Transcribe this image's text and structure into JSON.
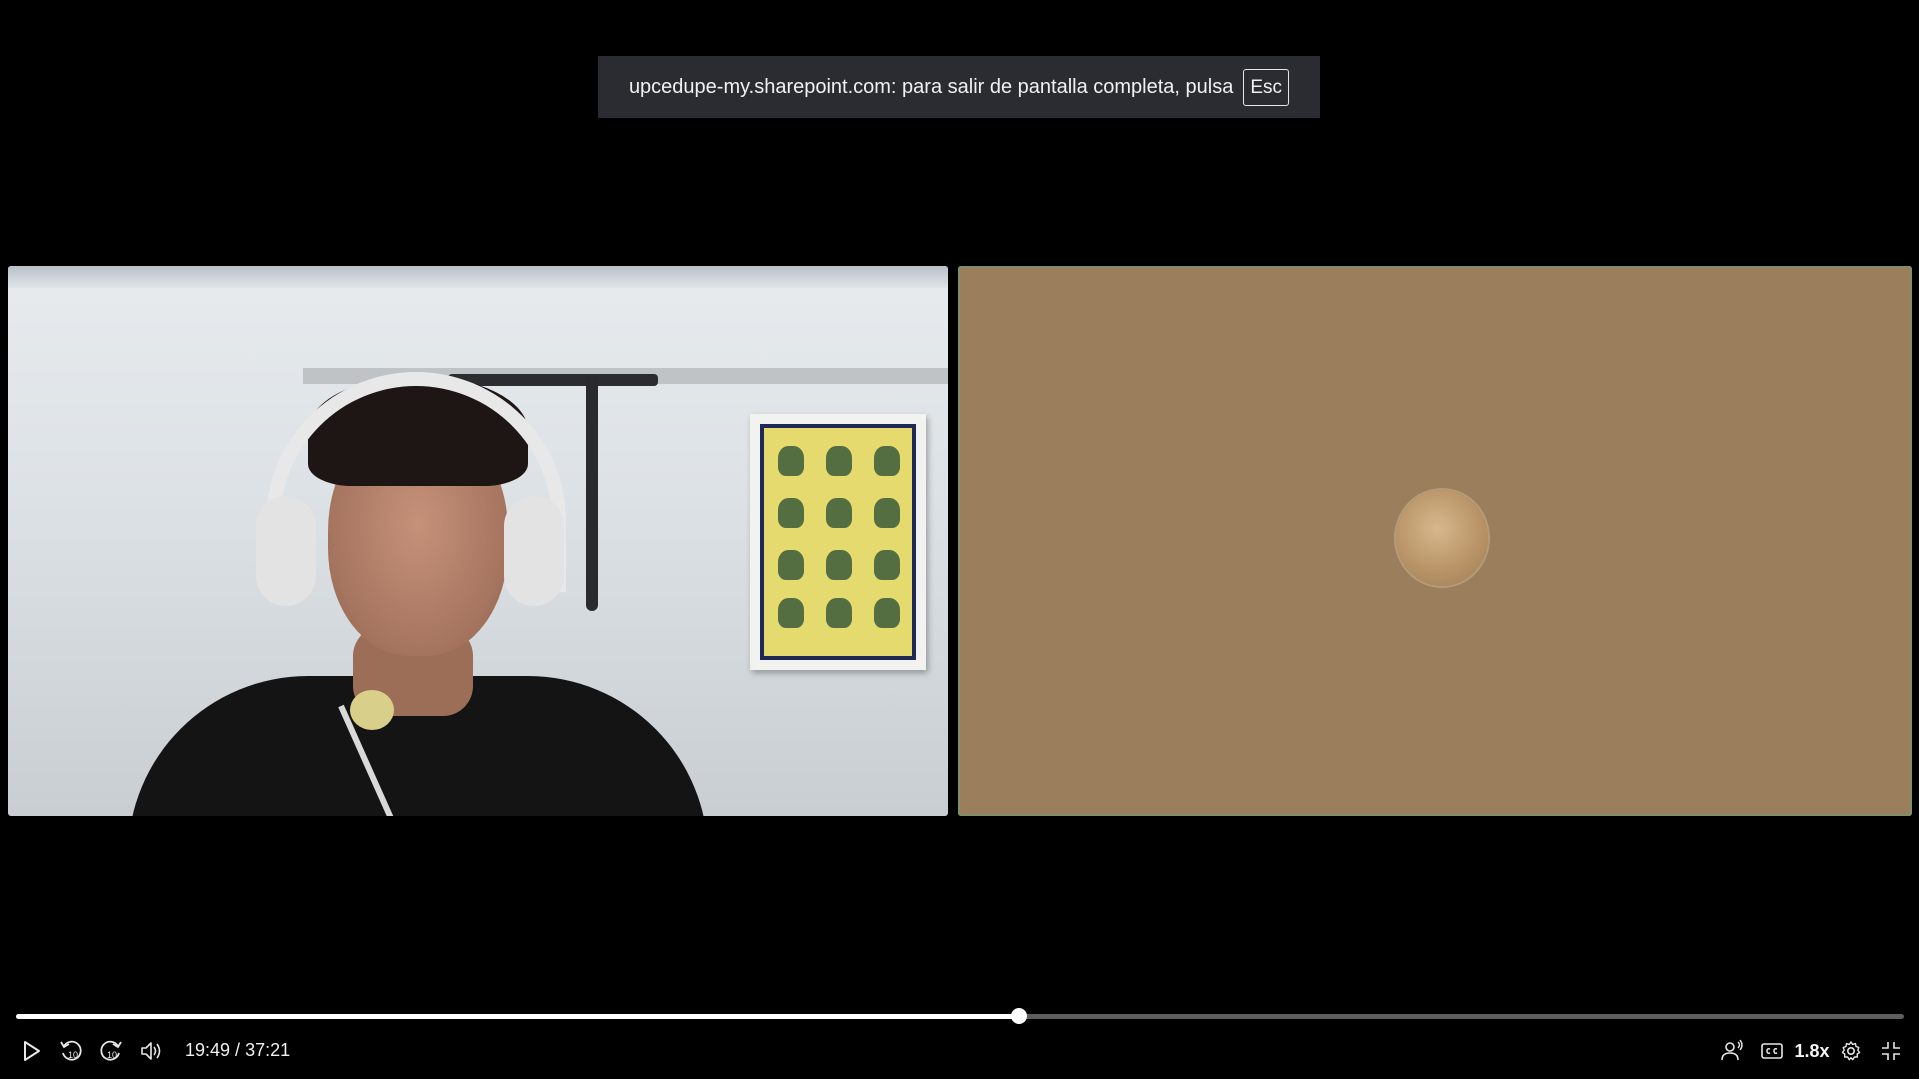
{
  "fullscreen_notice": {
    "message": "upcedupe-my.sharepoint.com: para salir de pantalla completa, pulsa",
    "key": "Esc"
  },
  "player": {
    "current_time": "19:49",
    "separator": " / ",
    "duration": "37:21",
    "progress_fraction": 0.531,
    "playback_speed": "1.8x",
    "icons": {
      "play": "play-icon",
      "rewind": "rewind-10-icon",
      "forward": "forward-10-icon",
      "volume": "volume-icon",
      "speaker_view": "speaker-view-icon",
      "captions": "captions-icon",
      "settings": "gear-icon",
      "exit_fullscreen": "exit-fullscreen-icon"
    },
    "seek_labels": {
      "back": "10",
      "forward": "10"
    }
  },
  "colors": {
    "background": "#000000",
    "notice_bg": "#2a2c31",
    "avatar_tile": "#9b7e5c",
    "progress_track": "#5e5e5e",
    "progress_fill": "#ffffff"
  }
}
